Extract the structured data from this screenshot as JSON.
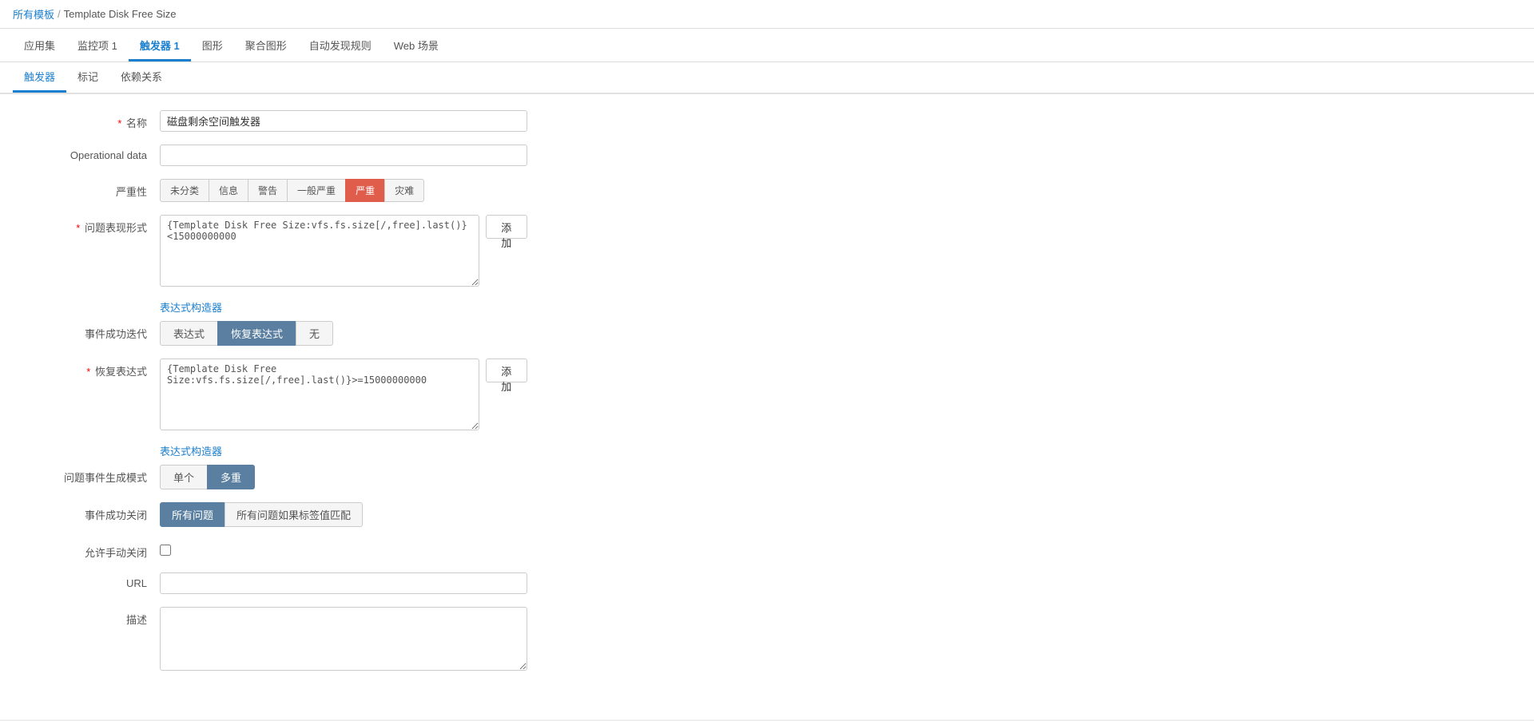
{
  "breadcrumb": {
    "root": "所有模板",
    "sep": "/",
    "current": "Template Disk Free Size"
  },
  "nav_tabs": [
    {
      "label": "应用集",
      "active": false
    },
    {
      "label": "监控项 1",
      "active": false
    },
    {
      "label": "触发器 1",
      "active": true
    },
    {
      "label": "图形",
      "active": false
    },
    {
      "label": "聚合图形",
      "active": false
    },
    {
      "label": "自动发现规则",
      "active": false
    },
    {
      "label": "Web 场景",
      "active": false
    }
  ],
  "sub_tabs": [
    {
      "label": "触发器",
      "active": true
    },
    {
      "label": "标记",
      "active": false
    },
    {
      "label": "依赖关系",
      "active": false
    }
  ],
  "form": {
    "name_label": "名称",
    "name_required": true,
    "name_value": "磁盘剩余空间触发器",
    "operational_data_label": "Operational data",
    "operational_data_value": "",
    "severity_label": "严重性",
    "severity_buttons": [
      {
        "label": "未分类",
        "active": false
      },
      {
        "label": "信息",
        "active": false
      },
      {
        "label": "警告",
        "active": false
      },
      {
        "label": "一般严重",
        "active": false
      },
      {
        "label": "严重",
        "active": true,
        "class": "active-high"
      },
      {
        "label": "灾难",
        "active": false
      }
    ],
    "problem_expr_label": "问题表现形式",
    "problem_expr_required": true,
    "problem_expr_value": "{Template Disk Free Size:vfs.fs.size[/,free].last()}<15000000000",
    "expr_builder_label": "表达式构造器",
    "recovery_iter_label": "事件成功迭代",
    "recovery_iter_buttons": [
      {
        "label": "表达式",
        "active": false
      },
      {
        "label": "恢复表达式",
        "active": true
      },
      {
        "label": "无",
        "active": false
      }
    ],
    "recovery_expr_label": "恢复表达式",
    "recovery_expr_required": true,
    "recovery_expr_value": "{Template Disk Free Size:vfs.fs.size[/,free].last()}>=15000000000",
    "recovery_expr_builder_label": "表达式构造器",
    "problem_event_mode_label": "问题事件生成模式",
    "problem_event_mode_buttons": [
      {
        "label": "单个",
        "active": false
      },
      {
        "label": "多重",
        "active": true
      }
    ],
    "event_close_label": "事件成功关闭",
    "event_close_buttons": [
      {
        "label": "所有问题",
        "active": true
      },
      {
        "label": "所有问题如果标签值匹配",
        "active": false
      }
    ],
    "allow_manual_close_label": "允许手动关闭",
    "allow_manual_close_checked": false,
    "url_label": "URL",
    "url_value": "",
    "desc_label": "描述",
    "desc_value": "",
    "add_label": "添加"
  }
}
